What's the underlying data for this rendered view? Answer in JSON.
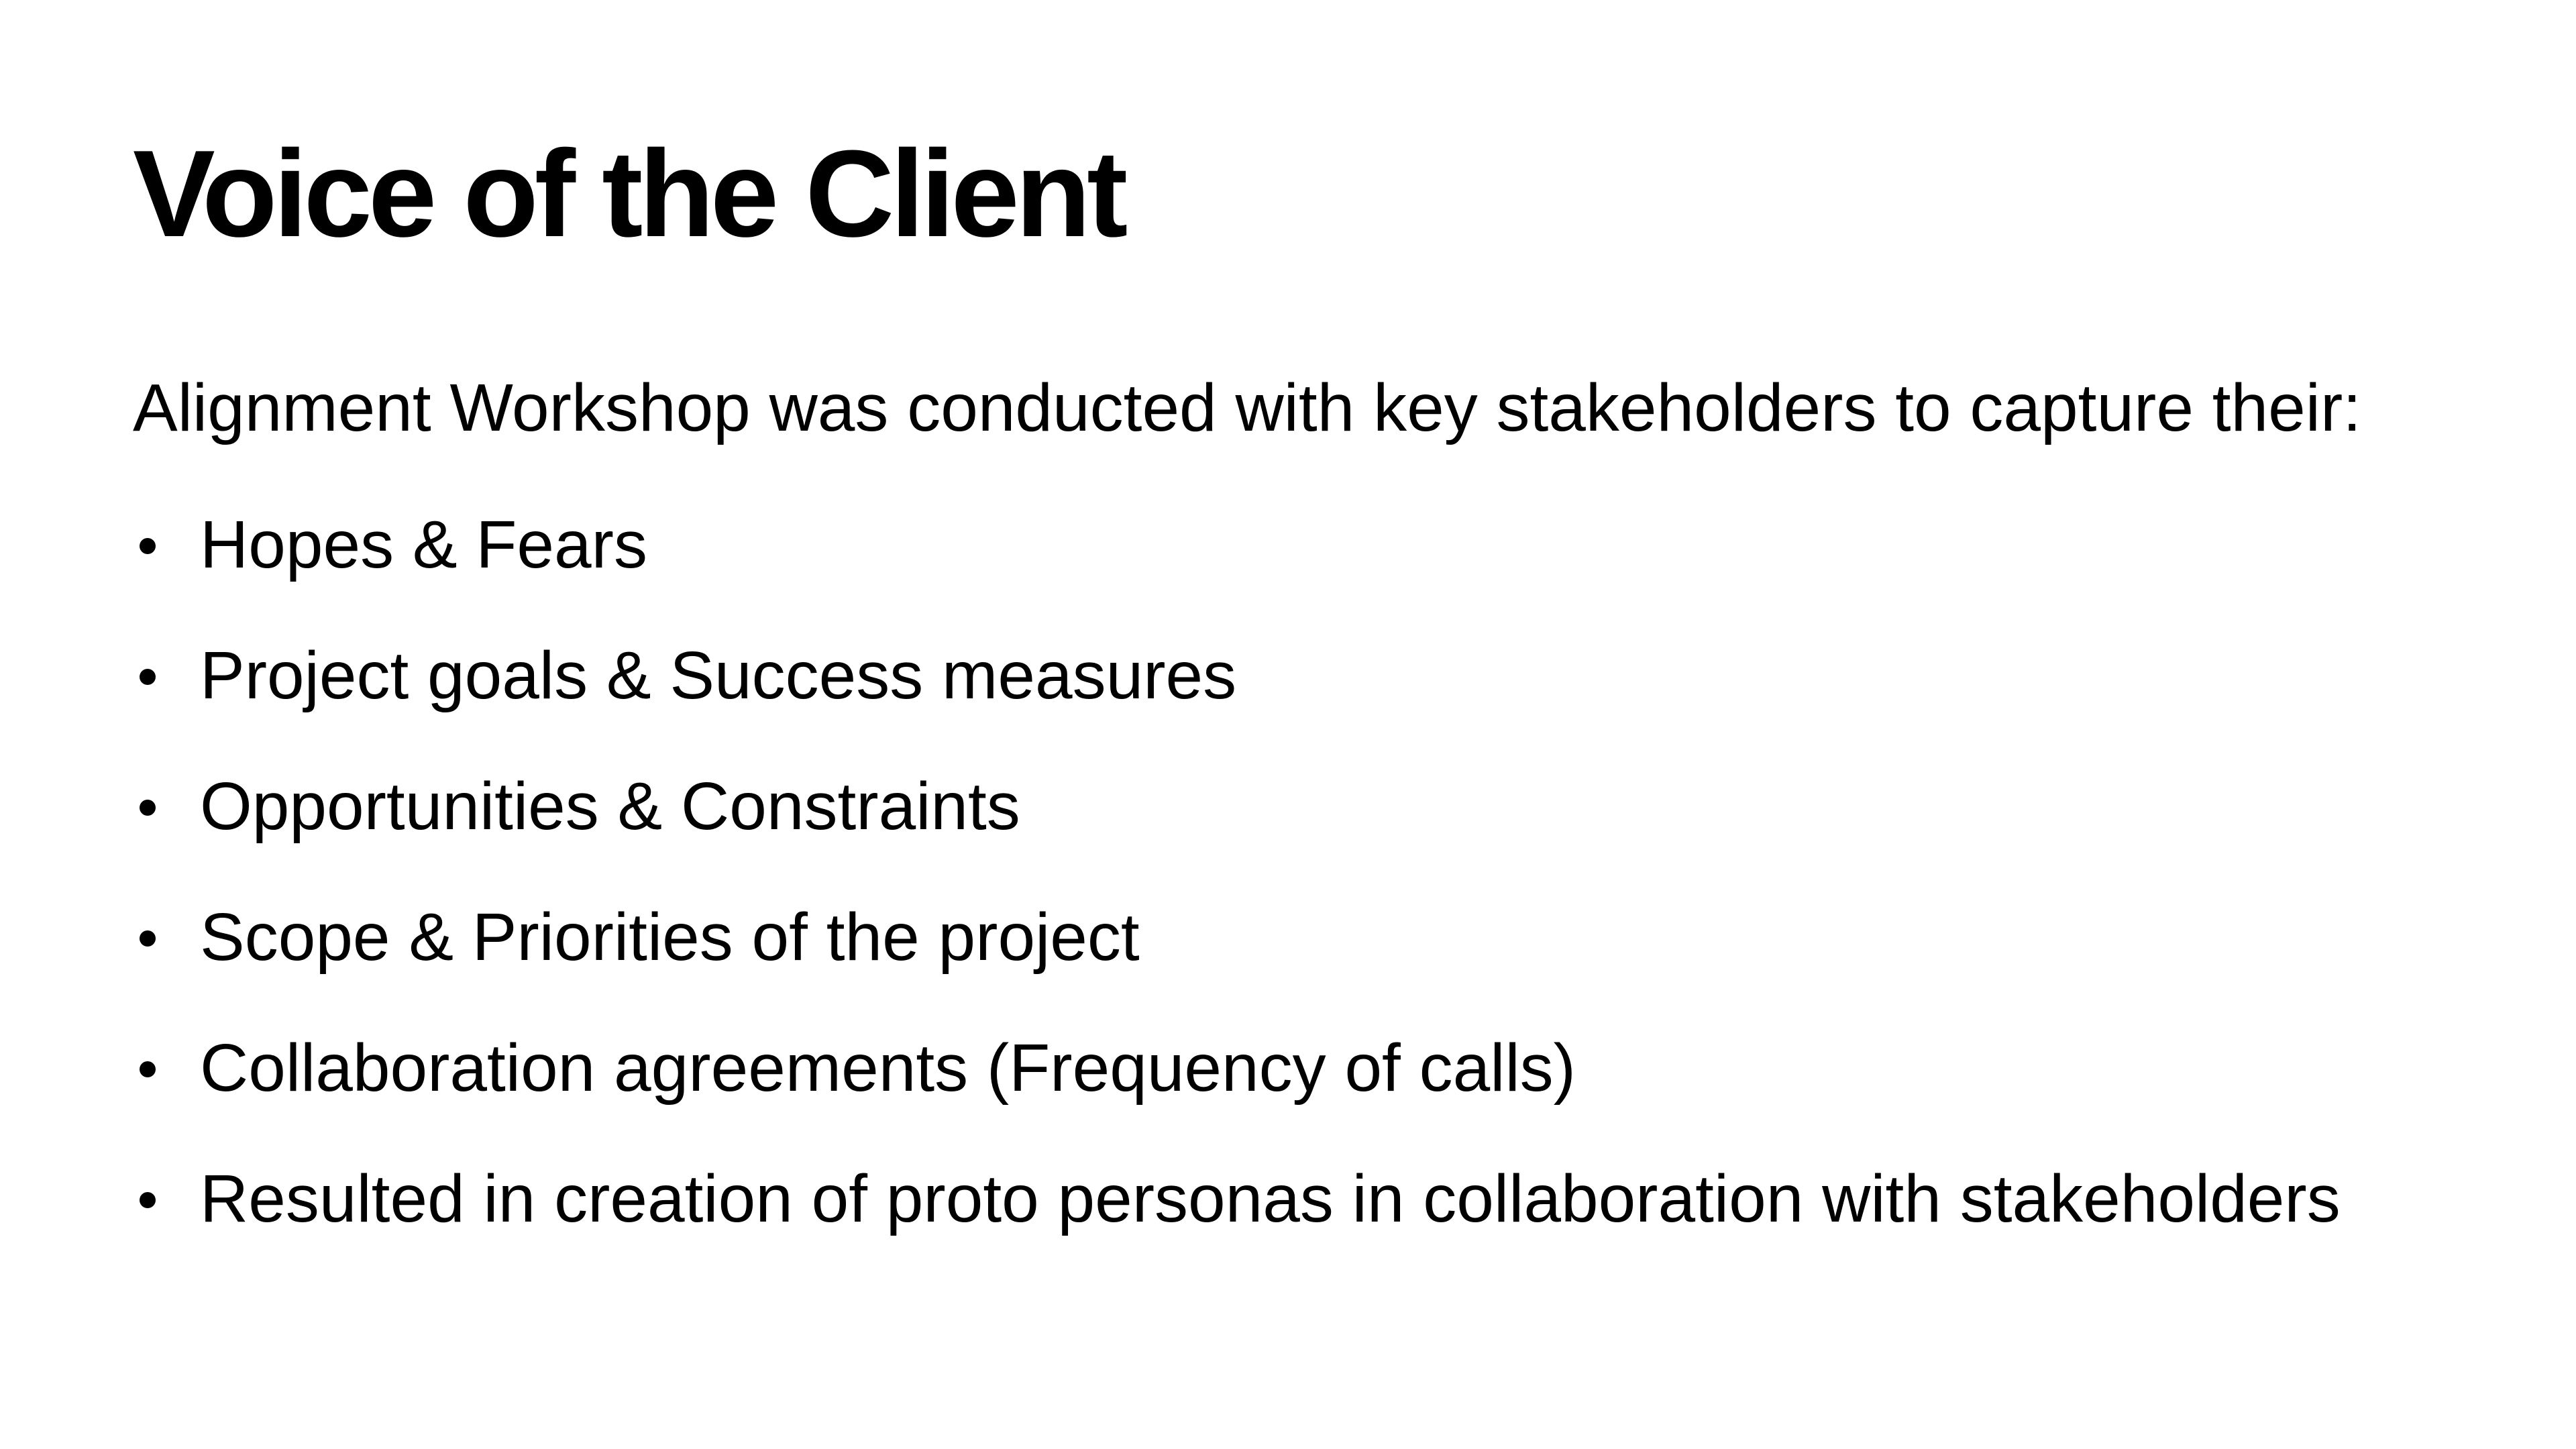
{
  "slide": {
    "title": "Voice of the Client",
    "intro": "Alignment Workshop was conducted with key stakeholders to capture their:",
    "bullets": [
      "Hopes & Fears",
      "Project goals & Success measures",
      "Opportunities & Constraints",
      "Scope & Priorities of the project",
      "Collaboration agreements (Frequency of calls)",
      "Resulted in creation of proto personas in collaboration with stakeholders"
    ]
  },
  "colors": {
    "background": "#ffffff",
    "text": "#000000"
  }
}
